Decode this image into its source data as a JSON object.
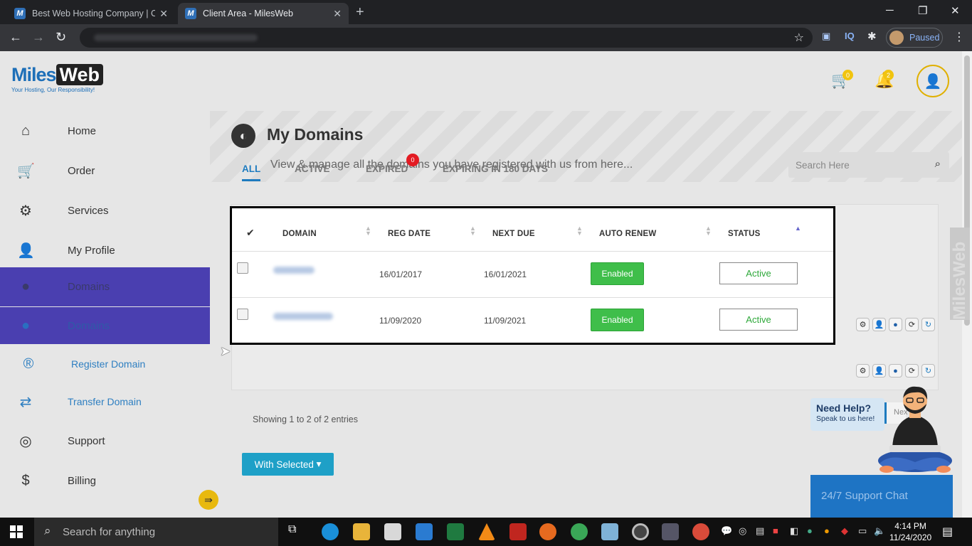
{
  "browser": {
    "tabs": [
      {
        "title": "Best Web Hosting Company | Ch",
        "favicon": "M"
      },
      {
        "title": "Client Area - MilesWeb",
        "favicon": "M",
        "active": true
      }
    ],
    "profile_status": "Paused",
    "ext_iq": "IQ"
  },
  "header": {
    "logo_main": "Miles",
    "logo_web": "Web",
    "logo_tagline": "Your Hosting, Our Responsibility!",
    "cart_count": "0",
    "notification_count": "2"
  },
  "sidebar": {
    "items": [
      {
        "label": "Home",
        "icon": "home-icon"
      },
      {
        "label": "Order",
        "icon": "cart-icon"
      },
      {
        "label": "Services",
        "icon": "gears-icon"
      },
      {
        "label": "My Profile",
        "icon": "user-icon"
      },
      {
        "label": "Domains",
        "icon": "globe-icon"
      },
      {
        "label": "Domains",
        "icon": "globe-icon"
      },
      {
        "label": "Register Domain",
        "icon": "registered-icon"
      },
      {
        "label": "Transfer Domain",
        "icon": "transfer-icon"
      },
      {
        "label": "Support",
        "icon": "lifebuoy-icon"
      },
      {
        "label": "Billing",
        "icon": "dollar-icon"
      }
    ]
  },
  "main": {
    "title": "My Domains",
    "subtitle": "View & manage all the domains you have registered with us from here...",
    "tabs": [
      {
        "label": "ALL",
        "selected": true
      },
      {
        "label": "ACTIVE"
      },
      {
        "label": "EXPIRED",
        "badge": "0"
      },
      {
        "label": "EXPIRING IN 180 DAYS"
      }
    ],
    "search_placeholder": "Search Here",
    "table": {
      "columns": [
        "DOMAIN",
        "REG DATE",
        "NEXT DUE",
        "AUTO RENEW",
        "STATUS"
      ],
      "rows": [
        {
          "reg_date": "16/01/2017",
          "next_due": "16/01/2021",
          "auto_renew": "Enabled",
          "status": "Active"
        },
        {
          "reg_date": "11/09/2020",
          "next_due": "11/09/2021",
          "auto_renew": "Enabled",
          "status": "Active"
        }
      ]
    },
    "showing": "Showing 1 to 2 of 2 entries",
    "with_selected": "With Selected"
  },
  "help": {
    "need_help": "Need Help?",
    "speak": "Speak to us here!",
    "next": "Nex",
    "chat": "24/7 Support Chat",
    "side_tag": "MilesWeb"
  },
  "taskbar": {
    "search_placeholder": "Search for anything",
    "time": "4:14 PM",
    "date": "11/24/2020"
  },
  "colors": {
    "accent": "#4a3fb0",
    "link": "#1e7bbf",
    "enabled": "#3fbe4a",
    "badge": "#e31b23"
  }
}
